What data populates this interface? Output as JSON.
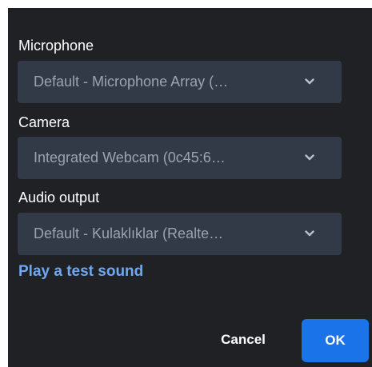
{
  "dialog": {
    "microphone": {
      "label": "Microphone",
      "value": "Default - Microphone Array (…"
    },
    "camera": {
      "label": "Camera",
      "value": "Integrated Webcam (0c45:6…"
    },
    "audio_output": {
      "label": "Audio output",
      "value": "Default - Kulaklıklar (Realte…"
    },
    "test_sound_label": "Play a test sound",
    "cancel_label": "Cancel",
    "ok_label": "OK"
  },
  "icons": {
    "dropdown": "chevron-down-icon"
  },
  "colors": {
    "panel_bg": "#202124",
    "select_bg": "#333a47",
    "select_text": "#9aa3b2",
    "link": "#6ea8f2",
    "primary": "#1a73e8"
  }
}
